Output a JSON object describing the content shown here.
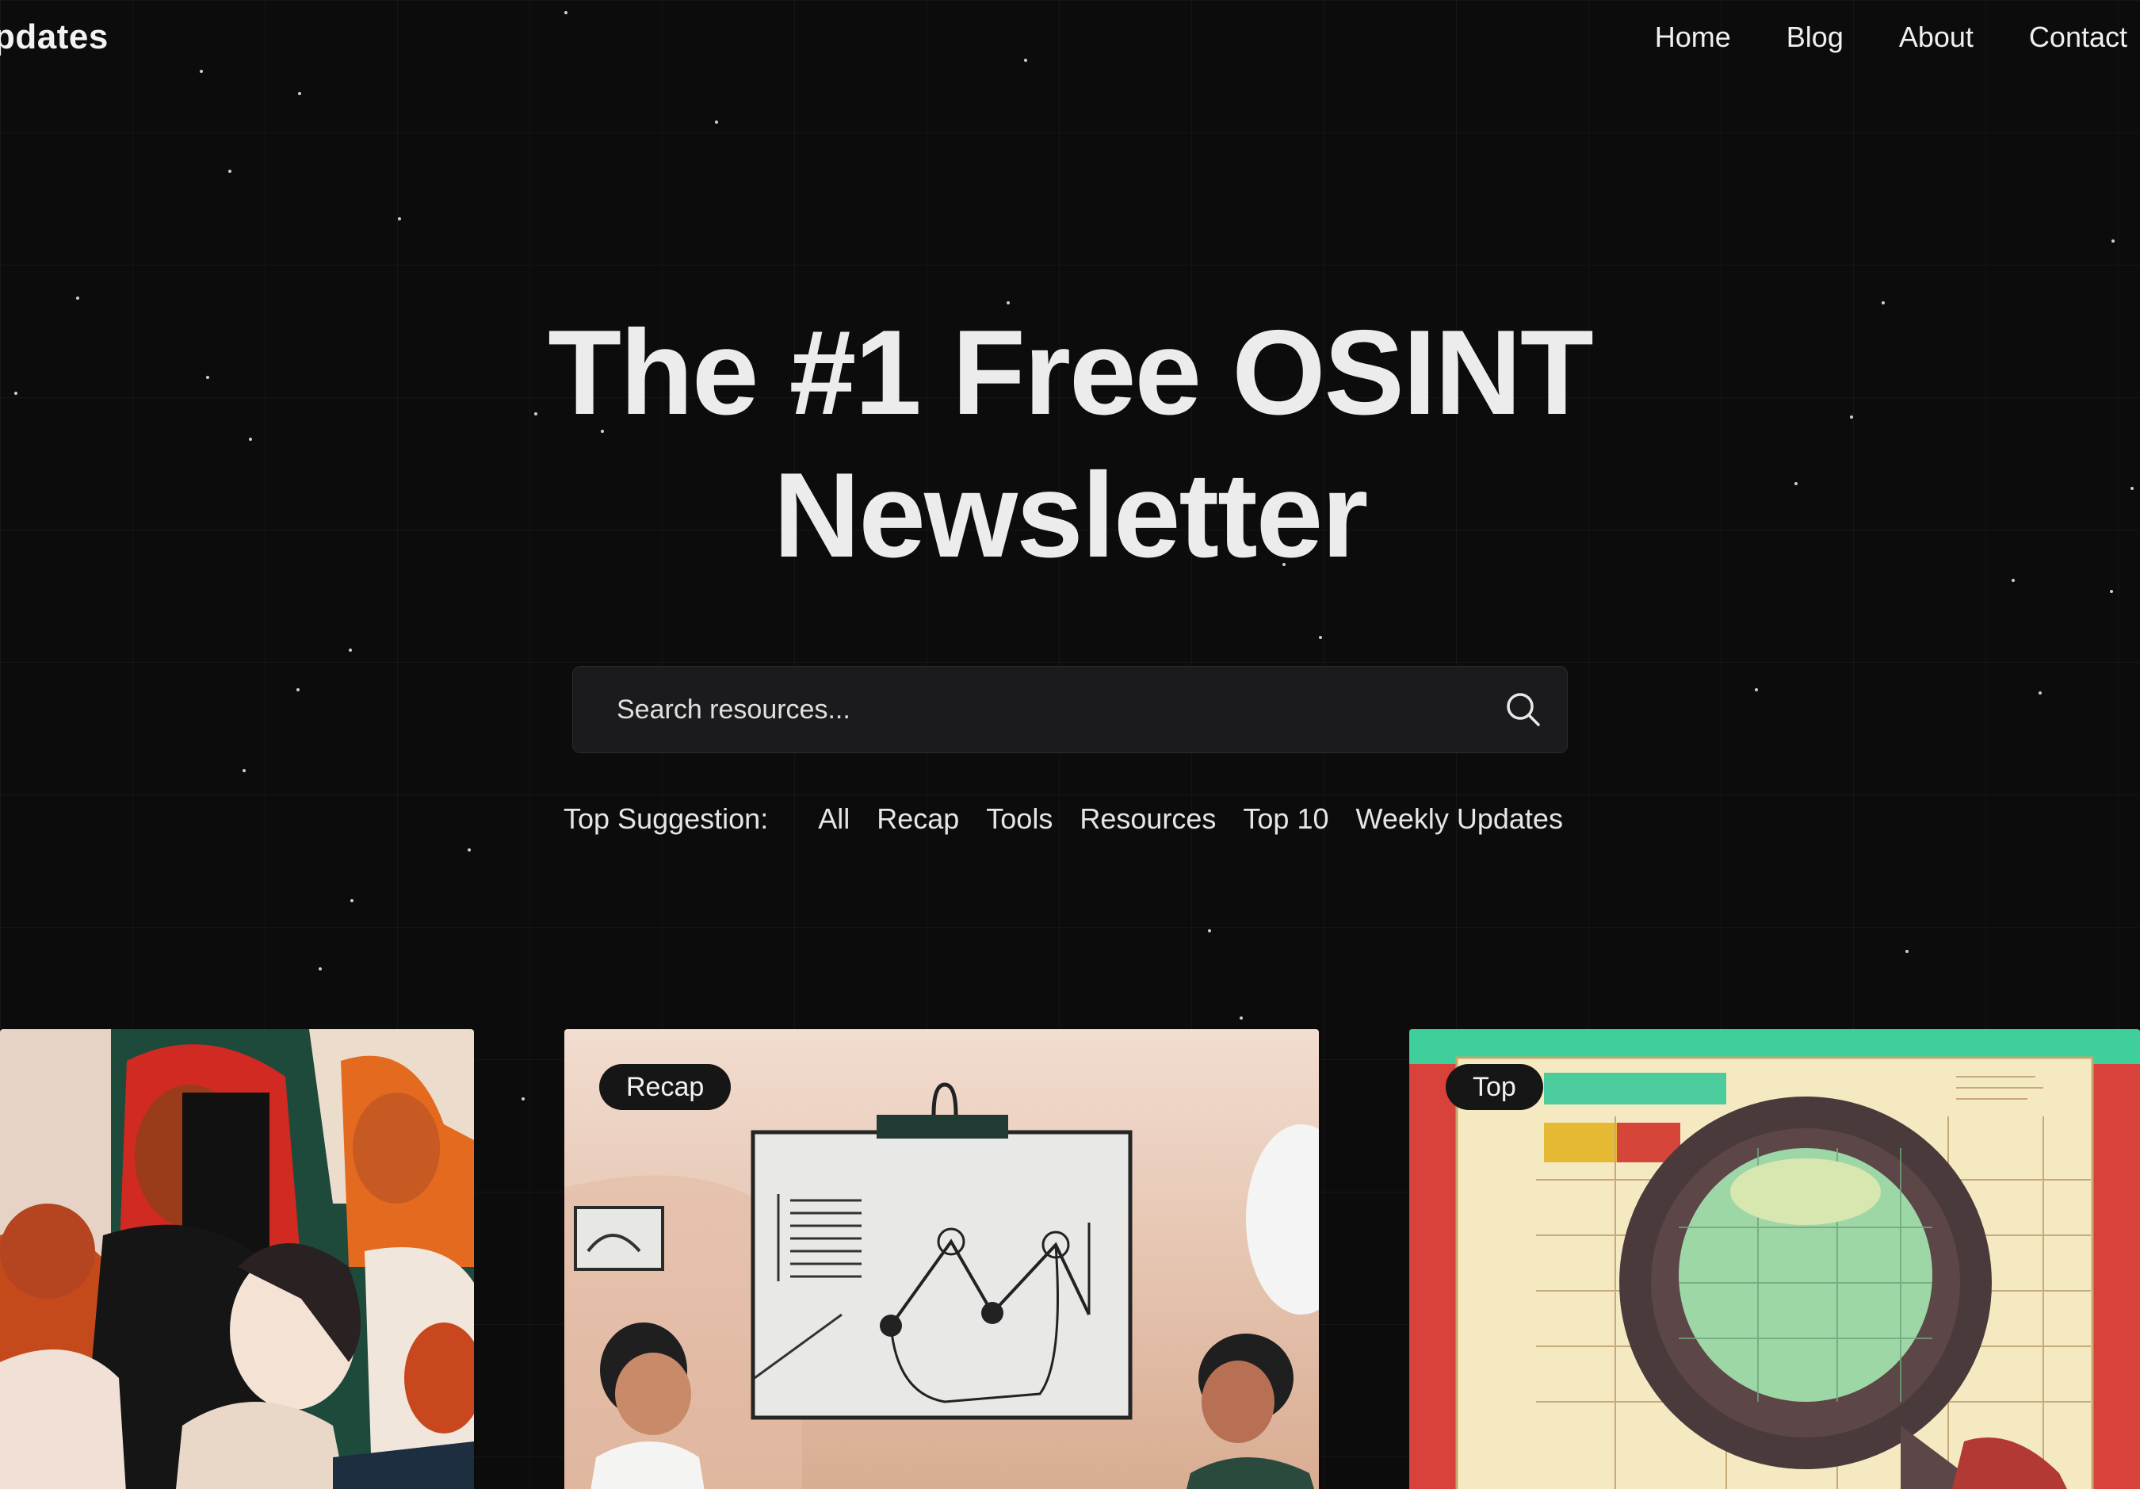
{
  "header": {
    "brand": "pdates",
    "nav": [
      "Home",
      "Blog",
      "About",
      "Contact"
    ]
  },
  "hero": {
    "title_line1": "The #1 Free OSINT",
    "title_line2": "Newsletter"
  },
  "search": {
    "placeholder": "Search resources...",
    "icon": "search-icon"
  },
  "suggestions": {
    "label": "Top Suggestion:",
    "items": [
      "All",
      "Recap",
      "Tools",
      "Resources",
      "Top 10",
      "Weekly Updates"
    ]
  },
  "cards": [
    {
      "badge": ""
    },
    {
      "badge": "Recap"
    },
    {
      "badge": "Top"
    }
  ],
  "colors": {
    "background": "#0c0c0d",
    "search_bg": "#1b1b1d",
    "text": "#ececec"
  }
}
